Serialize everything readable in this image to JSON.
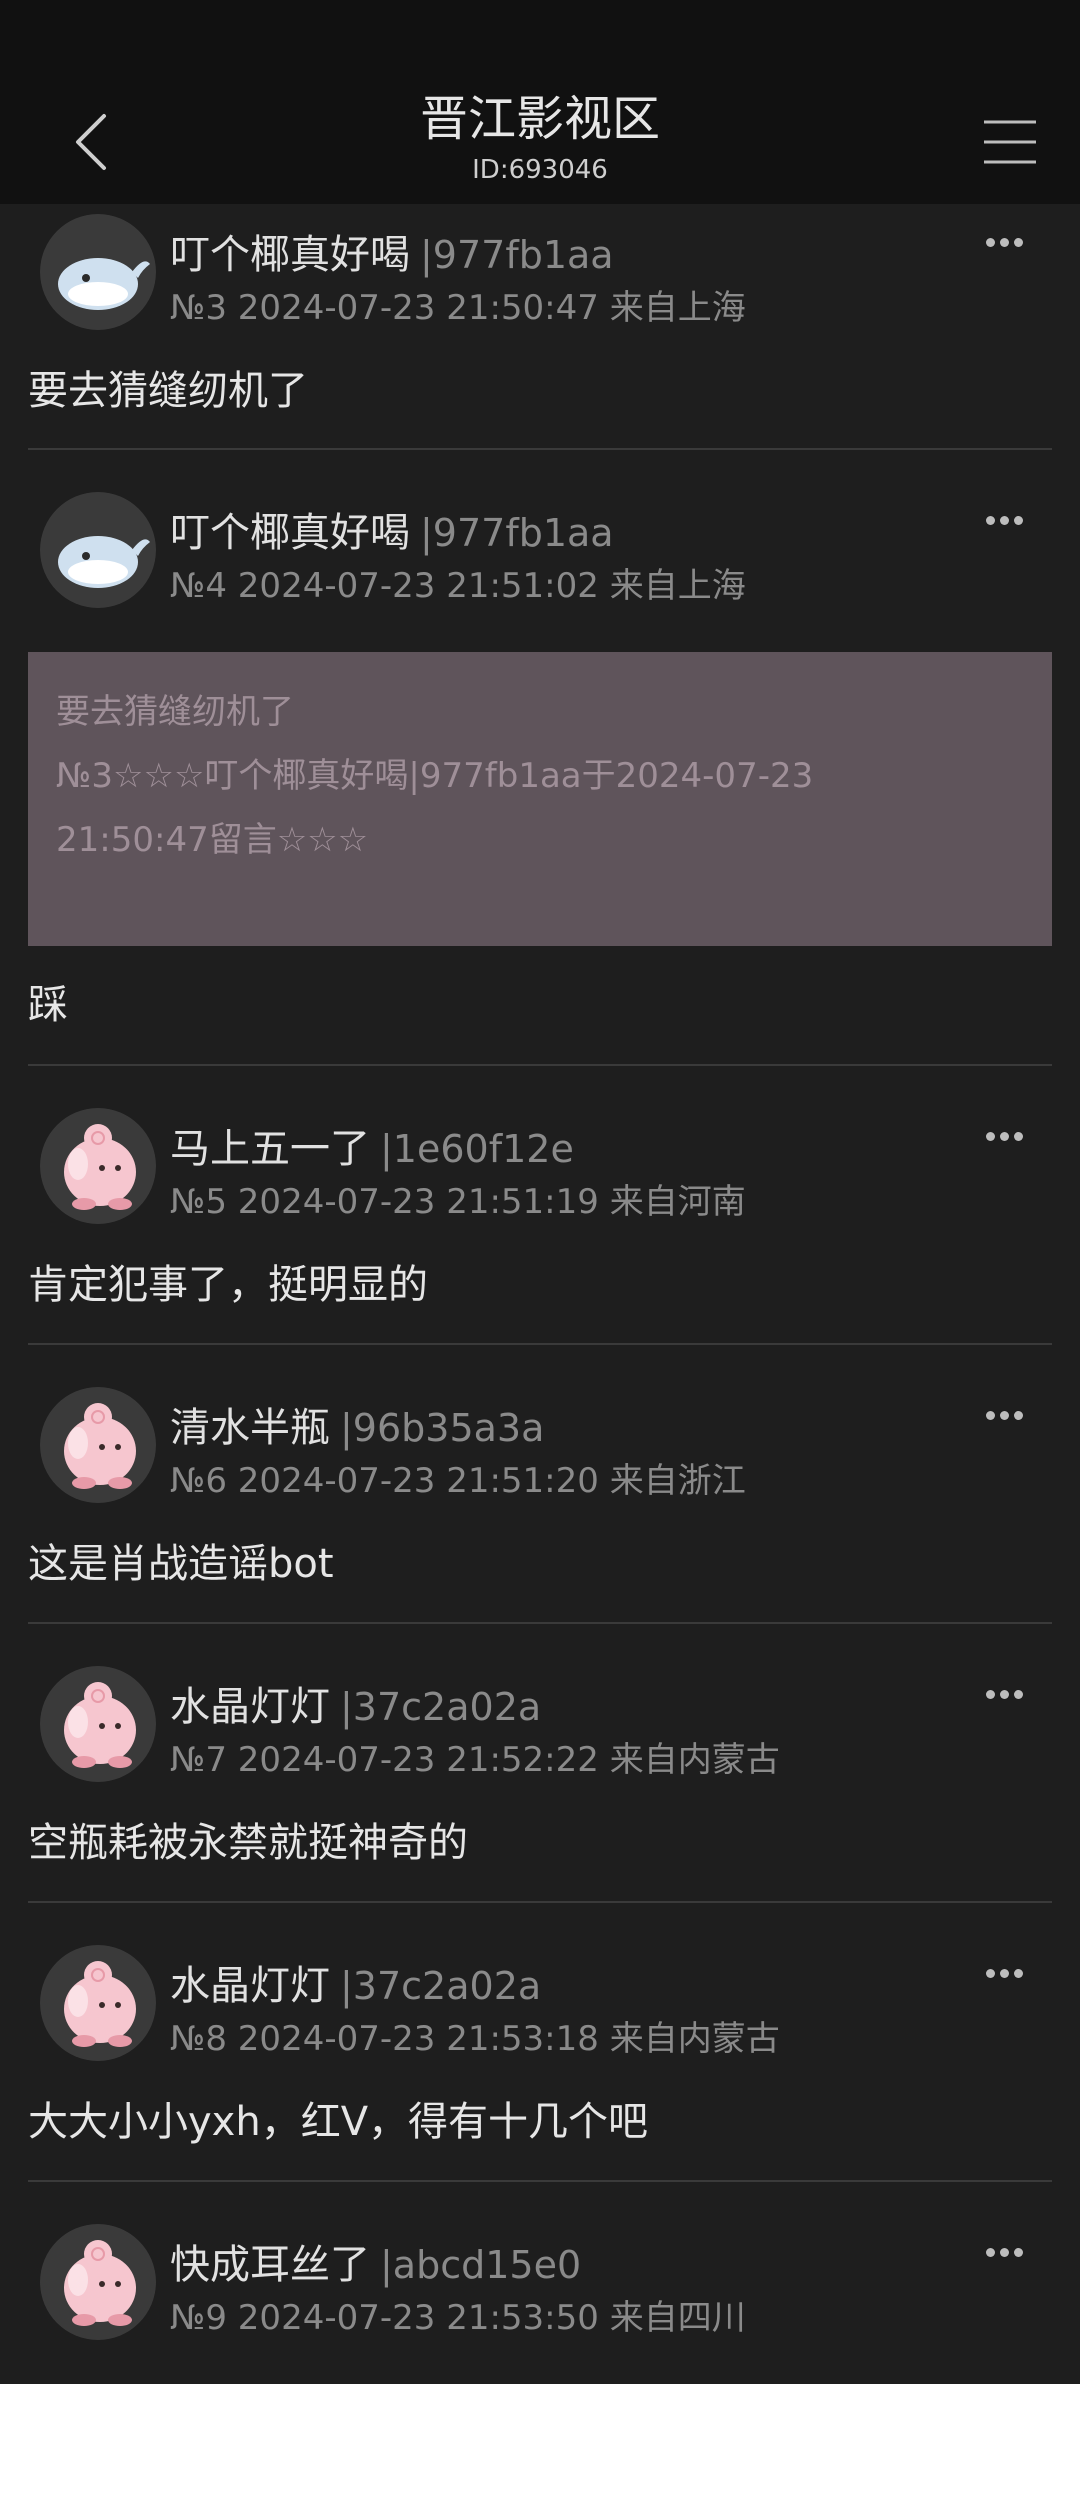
{
  "header": {
    "title": "晋江影视区",
    "subtitle": "ID:693046"
  },
  "posts": [
    {
      "username": "叮个椰真好喝",
      "uid": "|977fb1aa",
      "meta": "№3 2024-07-23 21:50:47 来自上海",
      "content": "要去猜缝纫机了",
      "avatar": "whale-avatar"
    },
    {
      "username": "叮个椰真好喝",
      "uid": "|977fb1aa",
      "meta": "№4 2024-07-23 21:51:02 来自上海",
      "quote": {
        "line1": "要去猜缝纫机了",
        "line2": "№3☆☆☆叮个椰真好喝|977fb1aa于2024-07-23",
        "line3": "21:50:47留言☆☆☆"
      },
      "content": "踩",
      "avatar": "whale-avatar"
    },
    {
      "username": "马上五一了",
      "uid": "|1e60f12e",
      "meta": "№5 2024-07-23 21:51:19 来自河南",
      "content": "肯定犯事了，挺明显的",
      "avatar": "pink-fairy-avatar"
    },
    {
      "username": "清水半瓶",
      "uid": "|96b35a3a",
      "meta": "№6 2024-07-23 21:51:20 来自浙江",
      "content": "这是肖战造谣bot",
      "avatar": "pink-fairy-avatar"
    },
    {
      "username": "水晶灯灯",
      "uid": "|37c2a02a",
      "meta": "№7 2024-07-23 21:52:22 来自内蒙古",
      "content": "空瓶耗被永禁就挺神奇的",
      "avatar": "pink-fairy-avatar"
    },
    {
      "username": "水晶灯灯",
      "uid": "|37c2a02a",
      "meta": "№8 2024-07-23 21:53:18 来自内蒙古",
      "content": "大大小小yxh，红V，得有十几个吧",
      "avatar": "pink-fairy-avatar"
    },
    {
      "username": "快成耳丝了",
      "uid": "|abcd15e0",
      "meta": "№9 2024-07-23 21:53:50 来自四川",
      "content": "",
      "avatar": "pink-fairy-avatar"
    }
  ],
  "colors": {
    "background": "#1e1e1e",
    "navbar": "#111111",
    "quote_bg": "#5f545b",
    "meta_text": "#8a8a8a"
  }
}
